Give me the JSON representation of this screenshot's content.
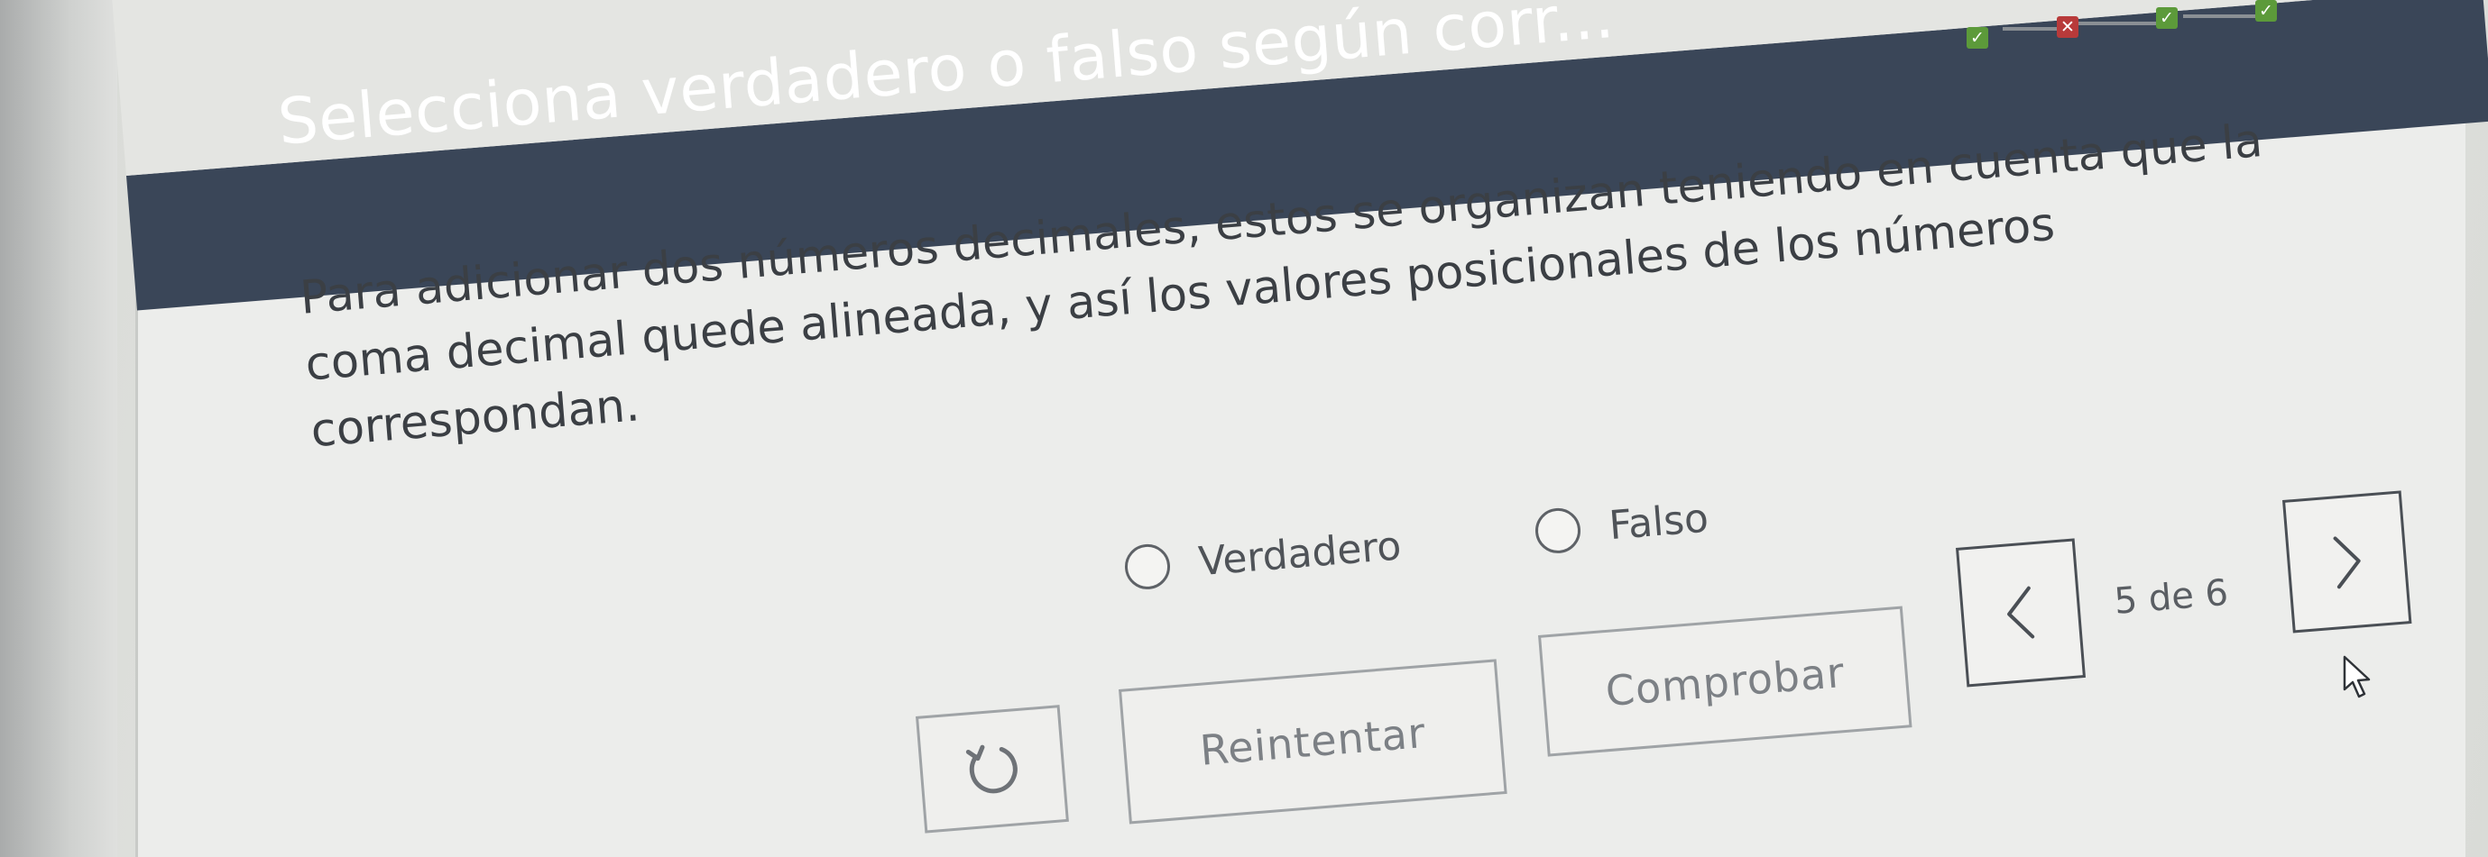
{
  "header": {
    "title": "Selecciona verdadero o falso según corr..."
  },
  "progress": {
    "marks": [
      "correct",
      "incorrect",
      "correct",
      "correct"
    ]
  },
  "question": {
    "lines": [
      "Para adicionar dos números decimales, estos se organizan teniendo en cuenta que la",
      "coma decimal quede alineada, y así los valores posicionales de los números",
      "correspondan."
    ]
  },
  "options": {
    "true_label": "Verdadero",
    "false_label": "Falso"
  },
  "actions": {
    "check_label": "Comprobar",
    "retry_label": "Reintentar"
  },
  "pagination": {
    "indicator": "5 de 6"
  },
  "colors": {
    "header_bg": "#3a4658",
    "correct": "#5c9a3a",
    "incorrect": "#b83a3a"
  },
  "icons": {
    "prev": "chevron-left-icon",
    "next": "chevron-right-icon",
    "reset": "undo-icon",
    "cursor": "mouse-pointer-icon"
  }
}
